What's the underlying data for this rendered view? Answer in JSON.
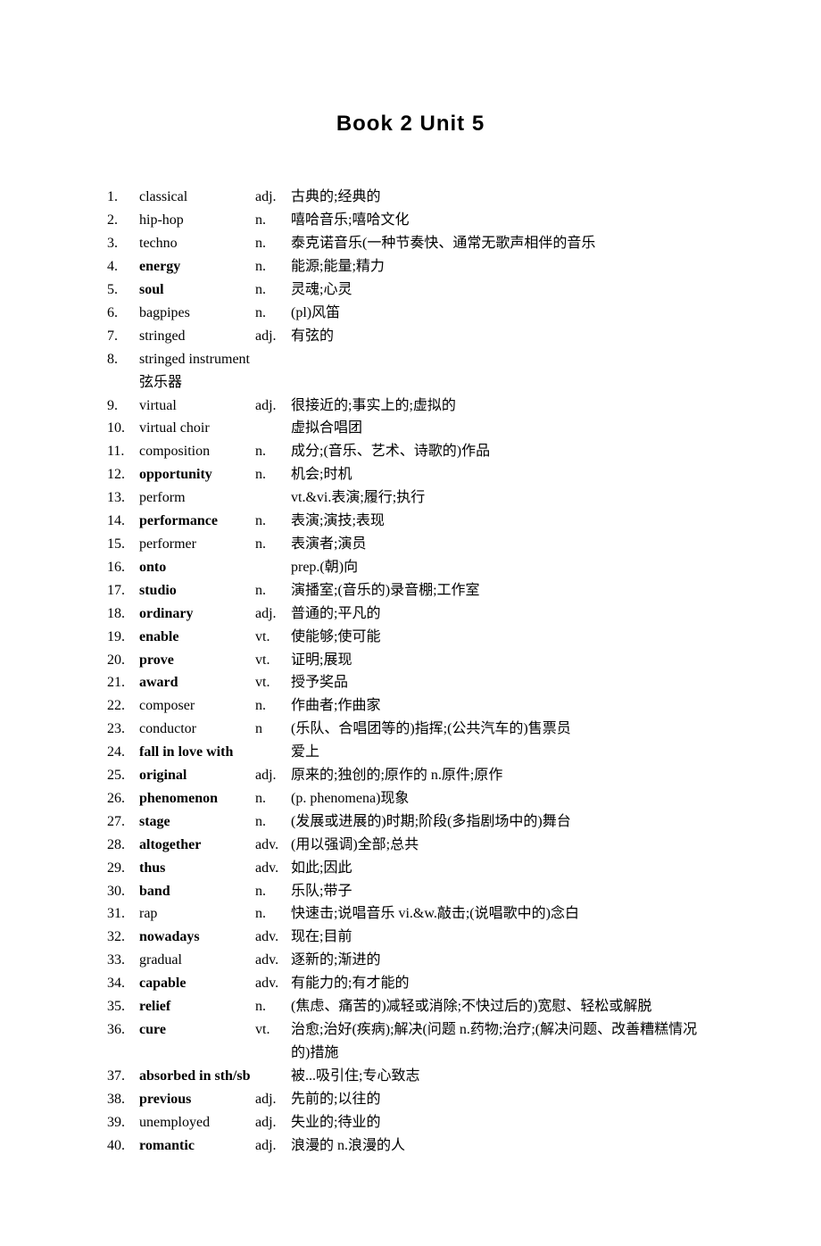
{
  "title": "Book 2 Unit 5",
  "entries": [
    {
      "num": "1.",
      "word": "classical",
      "bold": false,
      "pos": "adj.",
      "def": "古典的;经典的"
    },
    {
      "num": "2.",
      "word": "hip-hop",
      "bold": false,
      "pos": "n.",
      "def": "嘻哈音乐;嘻哈文化"
    },
    {
      "num": "3.",
      "word": "techno",
      "bold": false,
      "pos": "n.",
      "def": "泰克诺音乐(一种节奏快、通常无歌声相伴的音乐"
    },
    {
      "num": "4.",
      "word": "energy",
      "bold": true,
      "pos": "n.",
      "def": "能源;能量;精力"
    },
    {
      "num": "5.",
      "word": "soul",
      "bold": true,
      "pos": "n.",
      "def": "灵魂;心灵"
    },
    {
      "num": "6.",
      "word": "bagpipes",
      "bold": false,
      "pos": "n.",
      "def": "(pl)风笛"
    },
    {
      "num": "7.",
      "word": "stringed",
      "bold": false,
      "pos": "adj.",
      "def": "有弦的"
    },
    {
      "num": "8.",
      "word": "stringed instrument 弦乐器",
      "bold": false,
      "pos": "",
      "def": ""
    },
    {
      "num": "9.",
      "word": "virtual",
      "bold": false,
      "pos": "adj.",
      "def": "很接近的;事实上的;虚拟的"
    },
    {
      "num": "10.",
      "word": "virtual choir",
      "bold": false,
      "pos": "",
      "def": "虚拟合唱团"
    },
    {
      "num": "11.",
      "word": "composition",
      "bold": false,
      "pos": "n.",
      "def": "成分;(音乐、艺术、诗歌的)作品"
    },
    {
      "num": "12.",
      "word": "opportunity",
      "bold": true,
      "pos": "n.",
      "def": "机会;时机"
    },
    {
      "num": "13.",
      "word": "perform",
      "bold": false,
      "pos": "",
      "def": "vt.&vi.表演;履行;执行"
    },
    {
      "num": "14.",
      "word": "performance",
      "bold": true,
      "pos": "n.",
      "def": "表演;演技;表现"
    },
    {
      "num": "15.",
      "word": "performer",
      "bold": false,
      "pos": "n.",
      "def": "表演者;演员"
    },
    {
      "num": "16.",
      "word": "onto",
      "bold": true,
      "pos": "",
      "def": "prep.(朝)向"
    },
    {
      "num": "17.",
      "word": "studio",
      "bold": true,
      "pos": "n.",
      "def": "演播室;(音乐的)录音棚;工作室"
    },
    {
      "num": "18.",
      "word": "ordinary",
      "bold": true,
      "pos": "adj.",
      "def": "普通的;平凡的"
    },
    {
      "num": "19.",
      "word": "enable",
      "bold": true,
      "pos": "vt.",
      "def": "使能够;使可能"
    },
    {
      "num": "20.",
      "word": "prove",
      "bold": true,
      "pos": "vt.",
      "def": "证明;展现"
    },
    {
      "num": "21.",
      "word": "award",
      "bold": true,
      "pos": "vt.",
      "def": "授予奖品"
    },
    {
      "num": "22.",
      "word": "composer",
      "bold": false,
      "pos": "n.",
      "def": "作曲者;作曲家"
    },
    {
      "num": "23.",
      "word": "conductor",
      "bold": false,
      "pos": "n",
      "def": "(乐队、合唱团等的)指挥;(公共汽车的)售票员"
    },
    {
      "num": "24.",
      "word": "fall in love with",
      "bold": true,
      "pos": "",
      "def": "爱上"
    },
    {
      "num": "25.",
      "word": "original",
      "bold": true,
      "pos": "adj.",
      "def": "原来的;独创的;原作的 n.原件;原作"
    },
    {
      "num": "26.",
      "word": "phenomenon",
      "bold": true,
      "pos": "n.",
      "def": "(p. phenomena)现象"
    },
    {
      "num": "27.",
      "word": "stage",
      "bold": true,
      "pos": "n.",
      "def": "(发展或进展的)时期;阶段(多指剧场中的)舞台"
    },
    {
      "num": "28.",
      "word": "altogether",
      "bold": true,
      "pos": "adv.",
      "def": "(用以强调)全部;总共"
    },
    {
      "num": "29.",
      "word": "thus",
      "bold": true,
      "pos": "adv.",
      "def": "如此;因此"
    },
    {
      "num": "30.",
      "word": "band",
      "bold": true,
      "pos": "n.",
      "def": "乐队;带子"
    },
    {
      "num": "31.",
      "word": "rap",
      "bold": false,
      "pos": "n.",
      "def": "快速击;说唱音乐 vi.&w.敲击;(说唱歌中的)念白"
    },
    {
      "num": "32.",
      "word": "nowadays",
      "bold": true,
      "pos": "adv.",
      "def": "现在;目前"
    },
    {
      "num": "33.",
      "word": "gradual",
      "bold": false,
      "pos": "adv.",
      "def": "逐新的;渐进的"
    },
    {
      "num": "34.",
      "word": "capable",
      "bold": true,
      "pos": "adv.",
      "def": "有能力的;有才能的"
    },
    {
      "num": "35.",
      "word": "relief",
      "bold": true,
      "pos": "n.",
      "def": "(焦虑、痛苦的)减轻或消除;不快过后的)宽慰、轻松或解脱"
    },
    {
      "num": "36.",
      "word": "cure",
      "bold": true,
      "pos": "vt.",
      "def": "治愈;治好(疾病);解决(问题 n.药物;治疗;(解决问题、改善糟糕情况的)措施"
    },
    {
      "num": "37.",
      "word": "absorbed in sth/sb",
      "bold": true,
      "pos": "",
      "def": "被...吸引住;专心致志"
    },
    {
      "num": "38.",
      "word": "previous",
      "bold": true,
      "pos": "adj.",
      "def": "先前的;以往的"
    },
    {
      "num": "39.",
      "word": "unemployed",
      "bold": false,
      "pos": "adj.",
      "def": "失业的;待业的"
    },
    {
      "num": "40.",
      "word": "romantic",
      "bold": true,
      "pos": "adj.",
      "def": "浪漫的 n.浪漫的人"
    }
  ]
}
